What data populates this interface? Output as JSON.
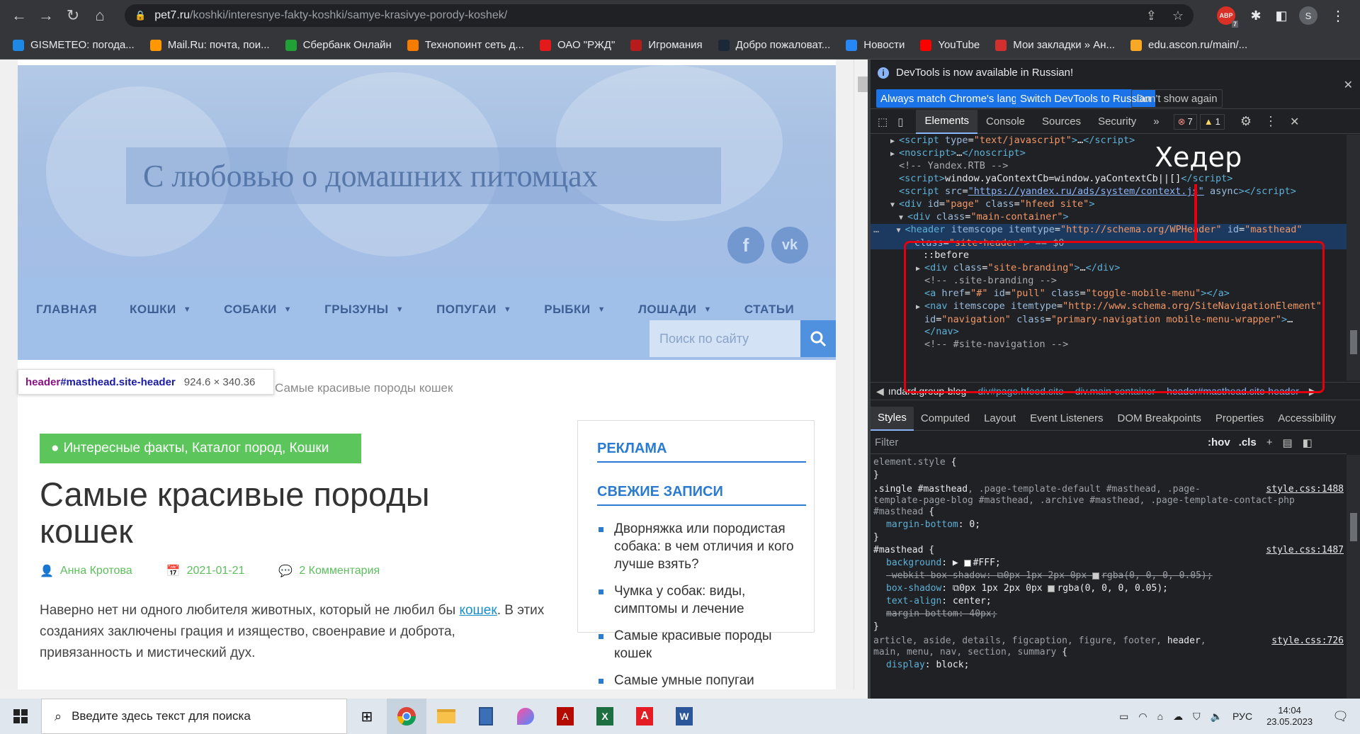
{
  "browser": {
    "url_host": "pet7.ru",
    "url_path": "/koshki/interesnye-fakty-koshki/samye-krasivye-porody-koshek/",
    "ext_badge": "7",
    "profile_initial": "S"
  },
  "bookmarks": [
    {
      "label": "GISMETEO: погода...",
      "color": "#1e88e5"
    },
    {
      "label": "Mail.Ru: почта, пои...",
      "color": "#ff9800"
    },
    {
      "label": "Сбербанк Онлайн",
      "color": "#21a038"
    },
    {
      "label": "Технопоинт сеть д...",
      "color": "#f57c00"
    },
    {
      "label": "ОАО \"РЖД\"",
      "color": "#e21a1a"
    },
    {
      "label": "Игромания",
      "color": "#b71c1c"
    },
    {
      "label": "Добро пожаловат...",
      "color": "#1b2838"
    },
    {
      "label": "Новости",
      "color": "#2787f5"
    },
    {
      "label": "YouTube",
      "color": "#ff0000"
    },
    {
      "label": "Мои закладки » Ан...",
      "color": "#d32f2f"
    },
    {
      "label": "edu.ascon.ru/main/...",
      "color": "#f9a825"
    }
  ],
  "site": {
    "title": "С любовью о домашних питомцах",
    "social_fb": "f",
    "social_vk": "vk",
    "nav": [
      {
        "label": "ГЛАВНАЯ",
        "dropdown": false
      },
      {
        "label": "КОШКИ",
        "dropdown": true
      },
      {
        "label": "СОБАКИ",
        "dropdown": true
      },
      {
        "label": "ГРЫЗУНЫ",
        "dropdown": true
      },
      {
        "label": "ПОПУГАИ",
        "dropdown": true
      },
      {
        "label": "РЫБКИ",
        "dropdown": true
      },
      {
        "label": "ЛОШАДИ",
        "dropdown": true
      },
      {
        "label": "СТАТЬИ",
        "dropdown": false
      }
    ],
    "search_placeholder": "Поиск по сайту"
  },
  "tooltip": {
    "selector_tag": "header",
    "selector_rest": "#masthead.site-header",
    "size": "924.6 × 340.36"
  },
  "breadcrumb": "Самые красивые породы кошек",
  "post": {
    "categories": "Интересные факты, Каталог пород, Кошки",
    "title": "Самые красивые породы кошек",
    "author": "Анна Кротова",
    "date": "2021-01-21",
    "comments": "2 Комментария",
    "intro_before": "Наверно нет ни одного любителя животных, который не любил бы ",
    "intro_link": "кошек",
    "intro_after": ". В этих созданиях заключены грация и изящество, своенравие и доброта, привязанность и мистический дух."
  },
  "sidebar": {
    "ad_heading": "РЕКЛАМА",
    "recent_heading": "СВЕЖИЕ ЗАПИСИ",
    "recent": [
      "Дворняжка или породистая собака: в чем отличия и кого лучше взять?",
      "Чумка у собак: виды, симптомы и лечение",
      "Самые красивые породы кошек",
      "Самые умные попугаи"
    ]
  },
  "devtools": {
    "info_text": "DevTools is now available in Russian!",
    "btn_match": "Always match Chrome's language",
    "btn_switch": "Switch DevTools to Russian",
    "btn_dont": "Don't show again",
    "tabs": [
      "Elements",
      "Console",
      "Sources",
      "Security"
    ],
    "more": "»",
    "errors": "7",
    "warnings": "1",
    "crumbs": [
      "ındard.group-blog",
      "div#page.hfeed.site",
      "div.main-container",
      "header#masthead.site-header"
    ],
    "style_tabs": [
      "Styles",
      "Computed",
      "Layout",
      "Event Listeners",
      "DOM Breakpoints",
      "Properties",
      "Accessibility"
    ],
    "filter_placeholder": "Filter",
    "hov": ":hov",
    "cls": ".cls"
  },
  "annotation": "Хедер",
  "taskbar": {
    "search_text": "Введите здесь текст для поиска",
    "lang": "РУС",
    "time": "14:04",
    "date": "23.05.2023"
  },
  "colors": {
    "accent_green": "#5cc65c",
    "link_blue": "#2a7bd1",
    "annotation_red": "#e4000f"
  }
}
